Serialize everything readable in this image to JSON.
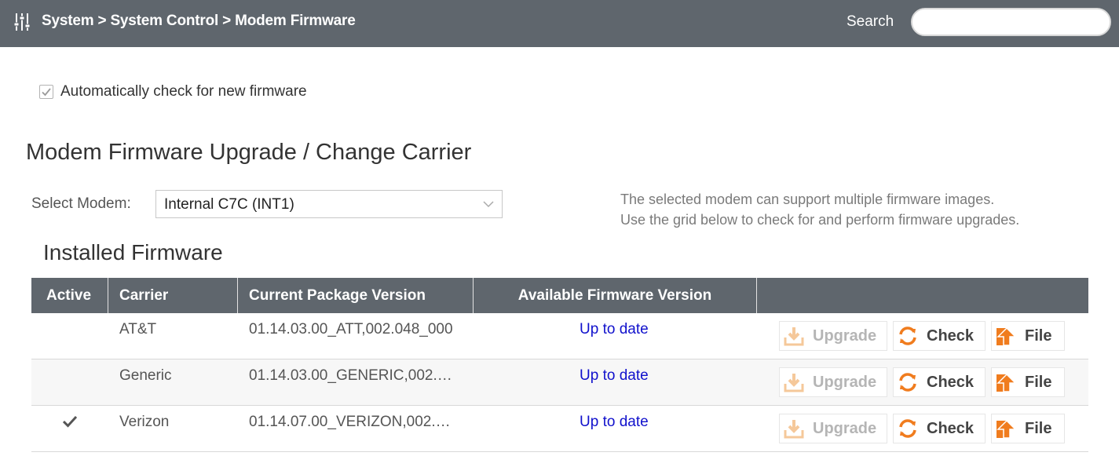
{
  "header": {
    "breadcrumb": "System > System Control > Modem Firmware",
    "search_label": "Search",
    "search_value": "",
    "menu_icon": "sliders-icon"
  },
  "auto_check": {
    "checked": true,
    "label": "Automatically check for new firmware"
  },
  "section_title": "Modem Firmware Upgrade / Change Carrier",
  "select_modem": {
    "label": "Select Modem:",
    "value": "Internal C7C  (INT1)"
  },
  "info": {
    "line1": "The selected modem can support multiple firmware images.",
    "line2": "Use the grid below to check for and perform firmware upgrades."
  },
  "installed_title": "Installed Firmware",
  "table": {
    "columns": [
      "Active",
      "Carrier",
      "Current Package Version",
      "Available Firmware Version",
      ""
    ],
    "rows": [
      {
        "active": false,
        "carrier": "AT&T",
        "version": "01.14.03.00_ATT,002.048_000",
        "available": "Up to date"
      },
      {
        "active": false,
        "carrier": "Generic",
        "version": "01.14.03.00_GENERIC,002.…",
        "available": "Up to date"
      },
      {
        "active": true,
        "carrier": "Verizon",
        "version": "01.14.07.00_VERIZON,002.…",
        "available": "Up to date"
      }
    ],
    "buttons": {
      "upgrade": "Upgrade",
      "check": "Check",
      "file": "File"
    }
  },
  "colors": {
    "header_bg": "#5f666d",
    "link": "#1111cc",
    "accent_orange": "#f07c1e"
  }
}
